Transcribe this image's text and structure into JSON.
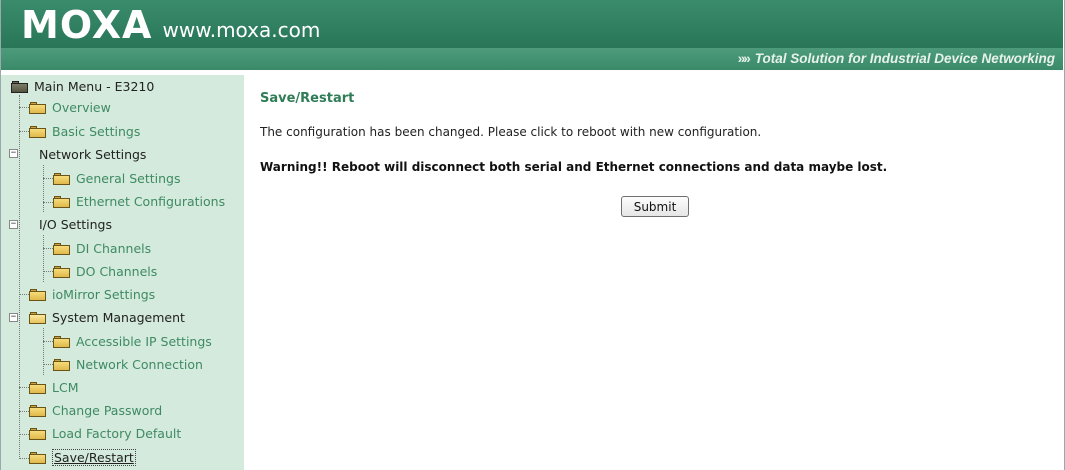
{
  "header": {
    "logo_text": "MOXA",
    "url": "www.moxa.com",
    "tagline": "Total Solution for Industrial Device Networking",
    "colors": {
      "banner": "#2c7a5c",
      "sidebar": "#d3eadc"
    }
  },
  "sidebar": {
    "root_label": "Main Menu - E3210",
    "items": [
      {
        "label": "Overview"
      },
      {
        "label": "Basic Settings"
      },
      {
        "label": "Network Settings"
      },
      {
        "label": "General Settings"
      },
      {
        "label": "Ethernet Configurations"
      },
      {
        "label": "I/O Settings"
      },
      {
        "label": "DI Channels"
      },
      {
        "label": "DO Channels"
      },
      {
        "label": "ioMirror Settings"
      },
      {
        "label": "System Management"
      },
      {
        "label": "Accessible IP Settings"
      },
      {
        "label": "Network Connection"
      },
      {
        "label": "LCM"
      },
      {
        "label": "Change Password"
      },
      {
        "label": "Load Factory Default"
      },
      {
        "label": "Save/Restart"
      }
    ]
  },
  "main": {
    "title": "Save/Restart",
    "message": "The configuration has been changed. Please click to reboot with new configuration.",
    "warning": "Warning!! Reboot will disconnect both serial and Ethernet connections and data maybe lost.",
    "submit_label": "Submit"
  }
}
